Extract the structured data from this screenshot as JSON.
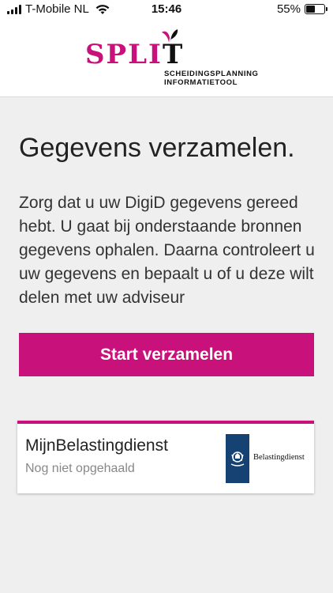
{
  "status_bar": {
    "carrier": "T-Mobile NL",
    "time": "15:46",
    "battery_percent": "55%",
    "battery_level": 0.55
  },
  "header": {
    "logo_text": "SPLIT",
    "logo_tagline_line1": "SCHEIDINGSPLANNING",
    "logo_tagline_line2": "INFORMATIETOOL"
  },
  "main": {
    "title": "Gegevens verzamelen.",
    "intro": "Zorg dat u uw DigiD gegevens gereed hebt. U gaat bij onderstaande bronnen gegevens ophalen. Daarna controleert u uw gegevens en bepaalt u of u deze wilt delen met uw adviseur",
    "start_button_label": "Start verzamelen"
  },
  "sources": [
    {
      "name": "MijnBelastingdienst",
      "status": "Nog niet opgehaald",
      "logo_label": "Belastingdienst",
      "logo_icon": "rijksoverheid-emblem-icon"
    }
  ],
  "colors": {
    "accent": "#c8117a",
    "background": "#efefef",
    "card_background": "#ffffff",
    "emblem_blue": "#154273"
  }
}
